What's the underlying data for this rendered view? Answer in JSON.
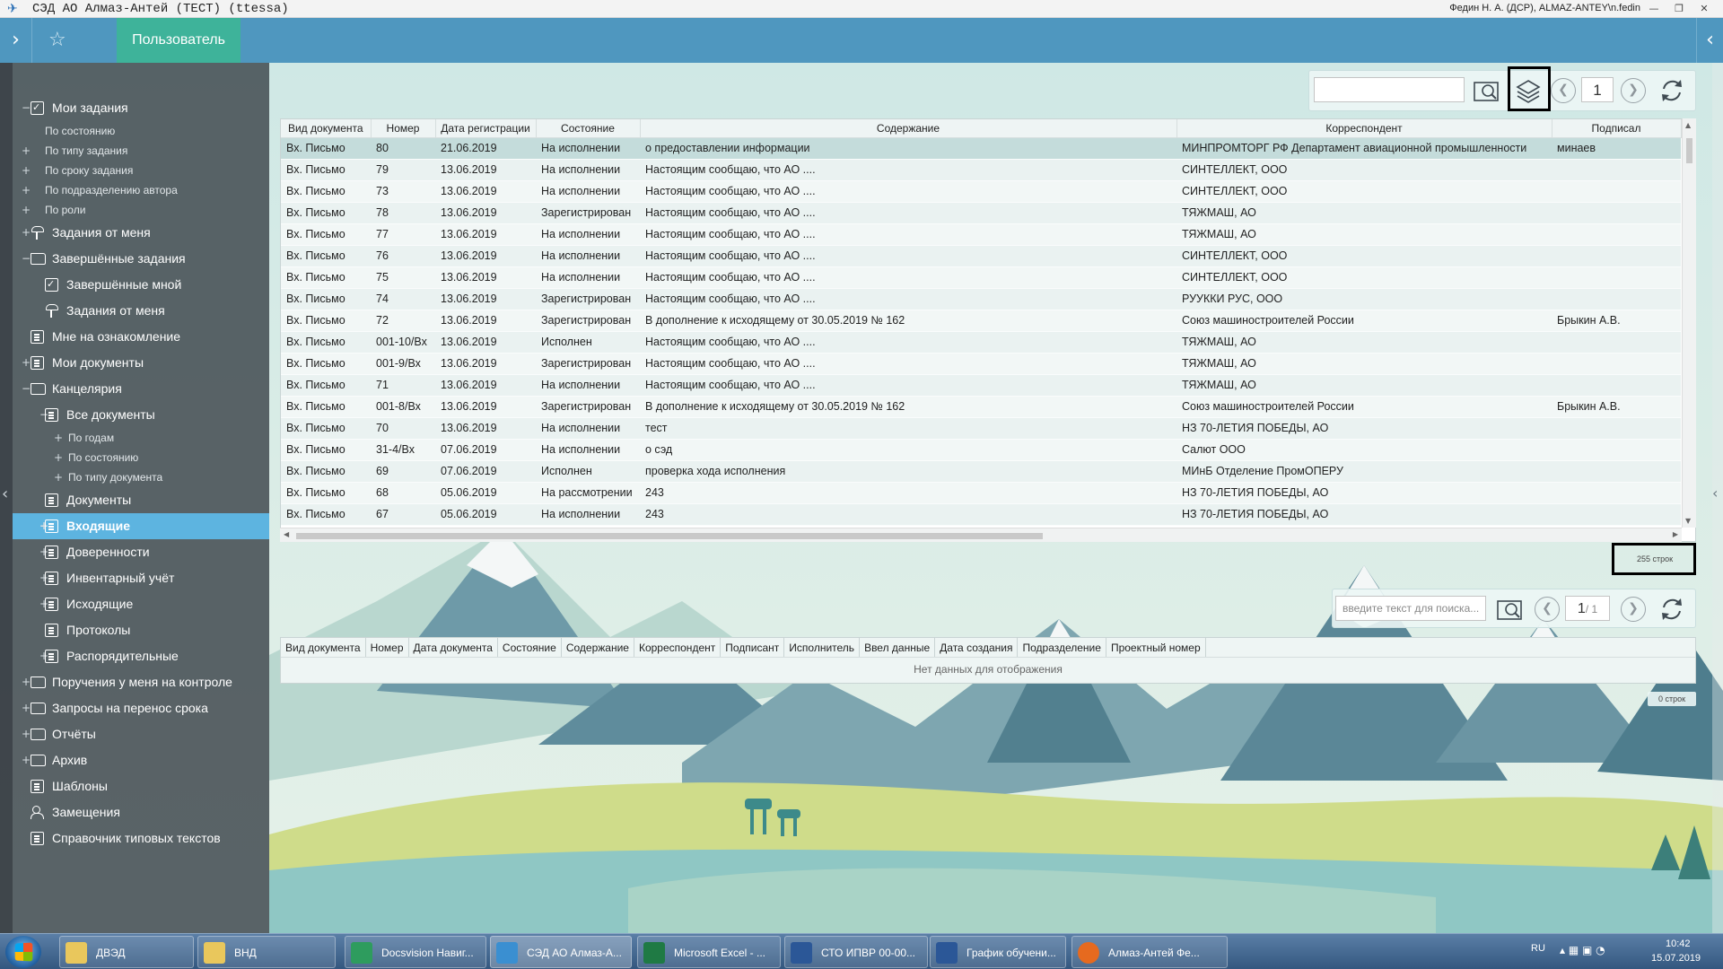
{
  "window": {
    "title": "СЭД АО Алмаз-Антей (ТЕСТ) (ttessa)",
    "user": "Федин Н. А. (ДСР), ALMAZ-ANTEY\\n.fedin"
  },
  "topbar": {
    "user_tab": "Пользователь"
  },
  "nav": [
    {
      "label": "Мои задания",
      "toggle": "−",
      "icon": "check",
      "level": 0
    },
    {
      "label": "По состоянию",
      "toggle": "",
      "level": 1
    },
    {
      "label": "По типу задания",
      "toggle": "+",
      "level": 1
    },
    {
      "label": "По сроку задания",
      "toggle": "+",
      "level": 1
    },
    {
      "label": "По подразделению автора",
      "toggle": "+",
      "level": 1
    },
    {
      "label": "По роли",
      "toggle": "+",
      "level": 1
    },
    {
      "label": "Задания от меня",
      "toggle": "+",
      "icon": "pin",
      "level": 0
    },
    {
      "label": "Завершённые задания",
      "toggle": "−",
      "icon": "folder",
      "level": 0
    },
    {
      "label": "Завершённые мной",
      "toggle": "",
      "icon": "check",
      "level": 2
    },
    {
      "label": "Задания от меня",
      "toggle": "",
      "icon": "pin",
      "level": 2
    },
    {
      "label": "Мне на ознакомление",
      "toggle": "",
      "icon": "doc",
      "level": 0
    },
    {
      "label": "Мои документы",
      "toggle": "+",
      "icon": "doc",
      "level": 0
    },
    {
      "label": "Канцелярия",
      "toggle": "−",
      "icon": "folder",
      "level": 0
    },
    {
      "label": "Все документы",
      "toggle": "−",
      "icon": "doc",
      "level": 2
    },
    {
      "label": "По годам",
      "toggle": "+",
      "level": 3
    },
    {
      "label": "По состоянию",
      "toggle": "+",
      "level": 3
    },
    {
      "label": "По типу документа",
      "toggle": "+",
      "level": 3
    },
    {
      "label": "Документы",
      "toggle": "",
      "icon": "doc",
      "level": 2
    },
    {
      "label": "Входящие",
      "toggle": "+",
      "icon": "doc",
      "level": 2,
      "active": true
    },
    {
      "label": "Доверенности",
      "toggle": "+",
      "icon": "doc",
      "level": 2
    },
    {
      "label": "Инвентарный учёт",
      "toggle": "+",
      "icon": "doc",
      "level": 2
    },
    {
      "label": "Исходящие",
      "toggle": "+",
      "icon": "doc",
      "level": 2
    },
    {
      "label": "Протоколы",
      "toggle": "",
      "icon": "doc",
      "level": 2
    },
    {
      "label": "Распорядительные",
      "toggle": "+",
      "icon": "doc",
      "level": 2
    },
    {
      "label": "Поручения у меня на контроле",
      "toggle": "+",
      "icon": "folder",
      "level": 0
    },
    {
      "label": "Запросы на перенос срока",
      "toggle": "+",
      "icon": "folder",
      "level": 0
    },
    {
      "label": "Отчёты",
      "toggle": "+",
      "icon": "folder",
      "level": 0
    },
    {
      "label": "Архив",
      "toggle": "+",
      "icon": "folder",
      "level": 0
    },
    {
      "label": "Шаблоны",
      "toggle": "",
      "icon": "doc",
      "level": 0
    },
    {
      "label": "Замещения",
      "toggle": "",
      "icon": "people",
      "level": 0
    },
    {
      "label": "Справочник типовых текстов",
      "toggle": "",
      "icon": "doc",
      "level": 0
    }
  ],
  "grid1": {
    "page": "1",
    "row_count": "255 строк",
    "columns": [
      "Вид документа",
      "Номер",
      "Дата регистрации",
      "Состояние",
      "Содержание",
      "Корреспондент",
      "Подписал"
    ],
    "rows": [
      [
        "Вх. Письмо",
        "80",
        "21.06.2019",
        "На исполнении",
        "о предоставлении информации",
        "МИНПРОМТОРГ  РФ  Департамент авиационной промышленности",
        "минаев"
      ],
      [
        "Вх. Письмо",
        "79",
        "13.06.2019",
        "На исполнении",
        "Настоящим сообщаю, что АО ....",
        "СИНТЕЛЛЕКТ, ООО",
        ""
      ],
      [
        "Вх. Письмо",
        "73",
        "13.06.2019",
        "На исполнении",
        "Настоящим сообщаю, что АО ....",
        "СИНТЕЛЛЕКТ, ООО",
        ""
      ],
      [
        "Вх. Письмо",
        "78",
        "13.06.2019",
        "Зарегистрирован",
        "Настоящим сообщаю, что АО ....",
        "ТЯЖМАШ, АО",
        ""
      ],
      [
        "Вх. Письмо",
        "77",
        "13.06.2019",
        "На исполнении",
        "Настоящим сообщаю, что АО ....",
        "ТЯЖМАШ, АО",
        ""
      ],
      [
        "Вх. Письмо",
        "76",
        "13.06.2019",
        "На исполнении",
        "Настоящим сообщаю, что АО ....",
        "СИНТЕЛЛЕКТ, ООО",
        ""
      ],
      [
        "Вх. Письмо",
        "75",
        "13.06.2019",
        "На исполнении",
        "Настоящим сообщаю, что АО ....",
        "СИНТЕЛЛЕКТ, ООО",
        ""
      ],
      [
        "Вх. Письмо",
        "74",
        "13.06.2019",
        "Зарегистрирован",
        "Настоящим сообщаю, что АО ....",
        "РУУККИ РУС, ООО",
        ""
      ],
      [
        "Вх. Письмо",
        "72",
        "13.06.2019",
        "Зарегистрирован",
        "В дополнение к исходящему от 30.05.2019 № 162",
        "Союз машиностроителей России",
        "Брыкин А.В."
      ],
      [
        "Вх. Письмо",
        "001-10/Вх",
        "13.06.2019",
        "Исполнен",
        "Настоящим сообщаю, что АО ....",
        "ТЯЖМАШ, АО",
        ""
      ],
      [
        "Вх. Письмо",
        "001-9/Вх",
        "13.06.2019",
        "Зарегистрирован",
        "Настоящим сообщаю, что АО ....",
        "ТЯЖМАШ, АО",
        ""
      ],
      [
        "Вх. Письмо",
        "71",
        "13.06.2019",
        "На исполнении",
        "Настоящим сообщаю, что АО ....",
        "ТЯЖМАШ, АО",
        ""
      ],
      [
        "Вх. Письмо",
        "001-8/Вх",
        "13.06.2019",
        "Зарегистрирован",
        "В дополнение к исходящему от 30.05.2019 № 162",
        "Союз машиностроителей России",
        "Брыкин А.В."
      ],
      [
        "Вх. Письмо",
        "70",
        "13.06.2019",
        "На исполнении",
        "тест",
        "НЗ 70-ЛЕТИЯ ПОБЕДЫ, АО",
        ""
      ],
      [
        "Вх. Письмо",
        "31-4/Вх",
        "07.06.2019",
        "На исполнении",
        "о сэд",
        "Салют ООО",
        ""
      ],
      [
        "Вх. Письмо",
        "69",
        "07.06.2019",
        "Исполнен",
        "проверка хода исполнения",
        "МИнБ Отделение ПромОПЕРУ",
        ""
      ],
      [
        "Вх. Письмо",
        "68",
        "05.06.2019",
        "На рассмотрении",
        "243",
        "НЗ 70-ЛЕТИЯ ПОБЕДЫ, АО",
        ""
      ],
      [
        "Вх. Письмо",
        "67",
        "05.06.2019",
        "На исполнении",
        "243",
        "НЗ 70-ЛЕТИЯ ПОБЕДЫ, АО",
        ""
      ]
    ]
  },
  "grid2": {
    "search_placeholder": "введите текст для поиска...",
    "page": "1",
    "page_total": "/ 1",
    "columns": [
      "Вид документа",
      "Номер",
      "Дата документа",
      "Состояние",
      "Содержание",
      "Корреспондент",
      "Подписант",
      "Исполнитель",
      "Ввел данные",
      "Дата создания",
      "Подразделение",
      "Проектный номер"
    ],
    "empty_text": "Нет данных для отображения",
    "row_count": "0 строк"
  },
  "taskbar": {
    "items": [
      {
        "label": "ДВЭД",
        "icon": "folder-icon"
      },
      {
        "label": "ВНД",
        "icon": "folder-icon"
      },
      {
        "label": "Docsvision Навиг...",
        "icon": "docsvision-icon"
      },
      {
        "label": "СЭД АО Алмаз-А...",
        "icon": "app-icon"
      },
      {
        "label": "Microsoft Excel - ...",
        "icon": "excel-icon"
      },
      {
        "label": "СТО ИПВР 00-00...",
        "icon": "word-icon"
      },
      {
        "label": "График обучени...",
        "icon": "word-icon"
      },
      {
        "label": "Алмаз-Антей Фе...",
        "icon": "firefox-icon"
      }
    ],
    "lang": "RU",
    "time": "10:42",
    "date": "15.07.2019"
  },
  "colors": {
    "accent": "#4f97bf",
    "user_tab": "#3eb39a",
    "active_nav": "#5db4e0"
  }
}
